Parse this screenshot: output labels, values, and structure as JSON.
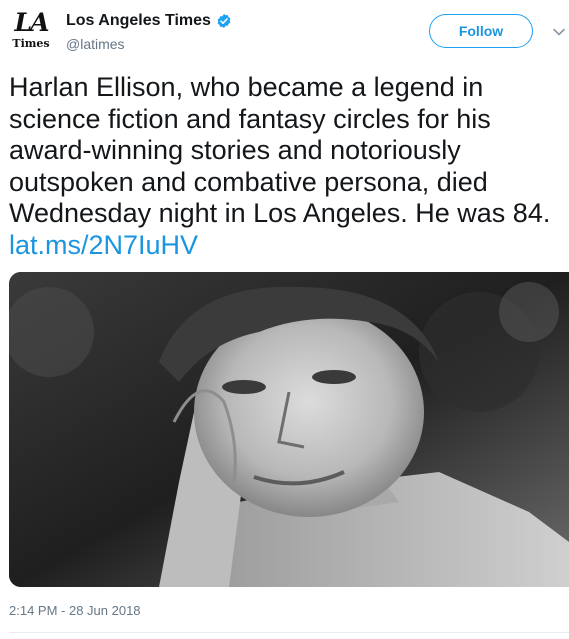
{
  "account": {
    "avatar_top": "LA",
    "avatar_bottom": "Times",
    "name": "Los Angeles Times",
    "handle": "@latimes",
    "verified": true
  },
  "actions": {
    "follow_label": "Follow"
  },
  "tweet": {
    "lines": [
      "Harlan Ellison, who became a legend in",
      "science fiction and fantasy circles for his",
      "award-winning stories and notoriously",
      "outspoken and combative persona, died",
      "Wednesday night in Los Angeles. He was 84."
    ],
    "link": "lat.ms/2N7IuHV",
    "timestamp": "2:14 PM - 28 Jun 2018"
  },
  "colors": {
    "accent": "#1da1f2",
    "link": "#1b95e0",
    "secondary_text": "#657786"
  },
  "icons": {
    "verified": "verified-badge-icon",
    "caret": "chevron-down-icon"
  }
}
